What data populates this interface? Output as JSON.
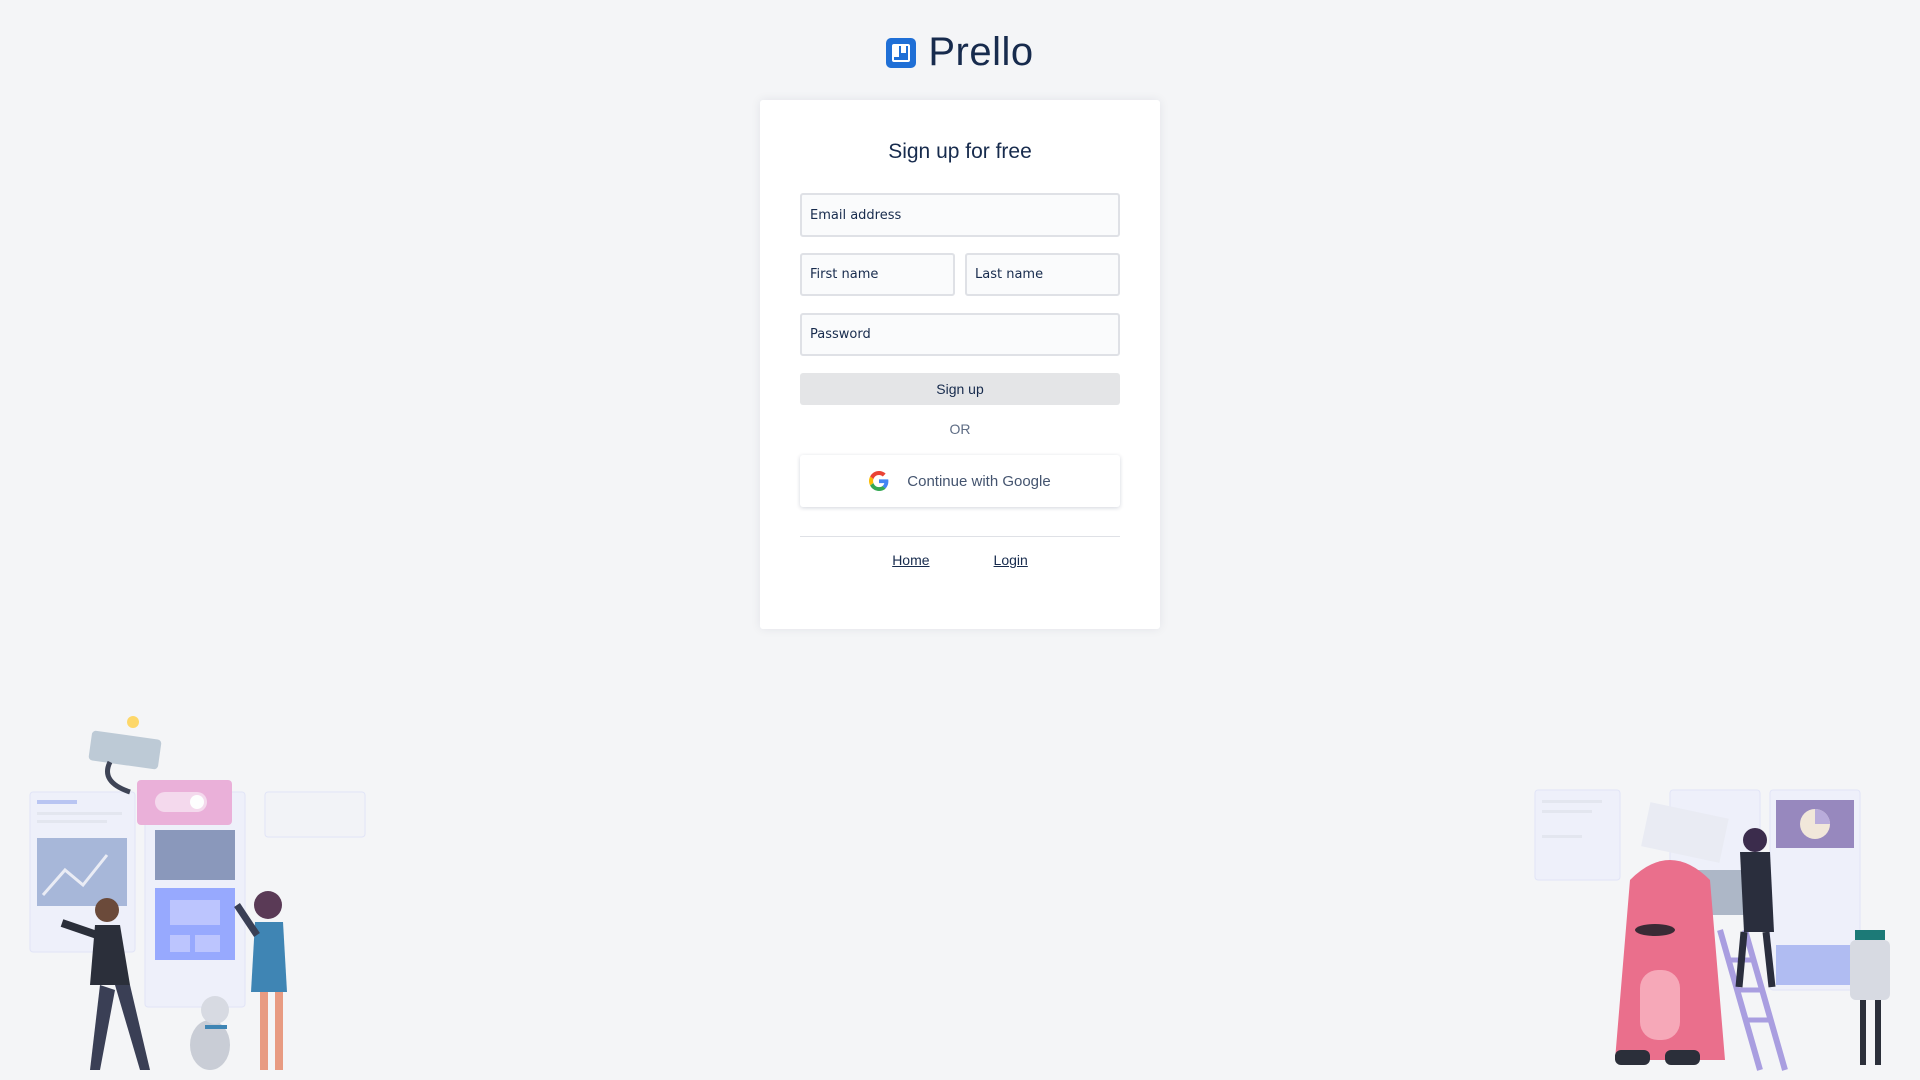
{
  "brand": {
    "name": "Prello"
  },
  "form": {
    "title": "Sign up for free",
    "email_placeholder": "Email address",
    "first_name_placeholder": "First name",
    "last_name_placeholder": "Last name",
    "password_placeholder": "Password",
    "signup_label": "Sign up",
    "or_text": "OR",
    "google_label": "Continue with Google"
  },
  "footer_links": {
    "home": "Home",
    "login": "Login"
  },
  "colors": {
    "background": "#f4f5f7",
    "brand_blue": "#1f6fd6",
    "text": "#172b4d"
  }
}
